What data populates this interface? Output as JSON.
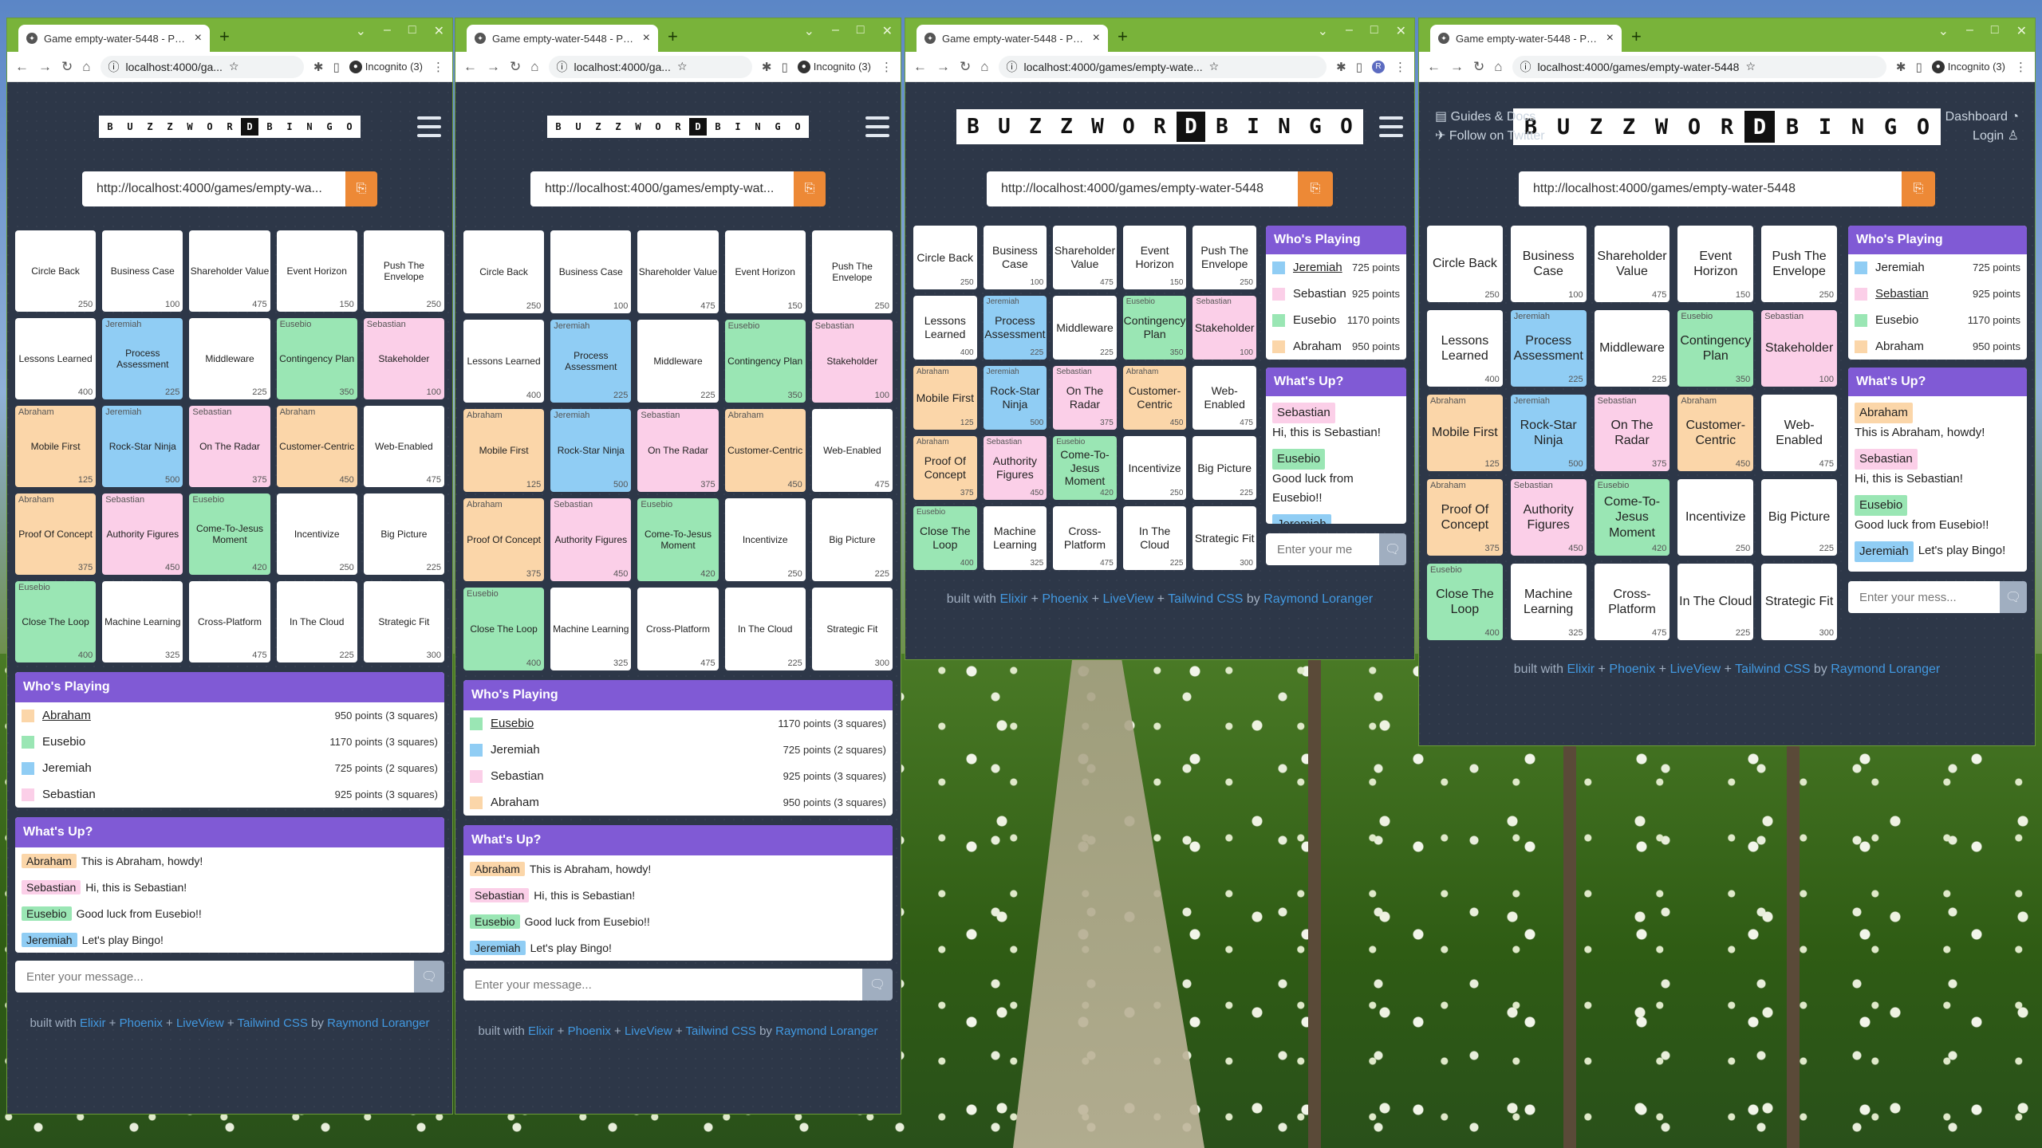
{
  "browser": {
    "tab_title": "Game empty-water-5448 - Phoenix",
    "new_tab": "+",
    "url_short": "localhost:4000/ga...",
    "url_long": "localhost:4000/games/empty-wate...",
    "url_full": "localhost:4000/games/empty-water-5448",
    "incognito": "Incognito (3)",
    "profile_initial": "R"
  },
  "logo": [
    "B",
    "U",
    "Z",
    "Z",
    "W",
    "O",
    "R",
    "D",
    "B",
    "I",
    "N",
    "G",
    "O"
  ],
  "header_links": {
    "guides": "Guides & Docs",
    "twitter": "Follow on Twitter",
    "dashboard": "Dashboard",
    "login": "Login"
  },
  "game_url": "http://localhost:4000/games/empty-water-5448",
  "game_url_short": "http://localhost:4000/games/empty-wa...",
  "game_url_short2": "http://localhost:4000/games/empty-wat...",
  "board": [
    {
      "label": "Circle Back",
      "points": "250",
      "by": "",
      "color": ""
    },
    {
      "label": "Business Case",
      "points": "100",
      "by": "",
      "color": ""
    },
    {
      "label": "Shareholder Value",
      "points": "475",
      "by": "",
      "color": ""
    },
    {
      "label": "Event Horizon",
      "points": "150",
      "by": "",
      "color": ""
    },
    {
      "label": "Push The Envelope",
      "points": "250",
      "by": "",
      "color": ""
    },
    {
      "label": "Lessons Learned",
      "points": "400",
      "by": "",
      "color": ""
    },
    {
      "label": "Process Assessment",
      "points": "225",
      "by": "Jeremiah",
      "color": "jeremiah"
    },
    {
      "label": "Middleware",
      "points": "225",
      "by": "",
      "color": ""
    },
    {
      "label": "Contingency Plan",
      "points": "350",
      "by": "Eusebio",
      "color": "eusebio"
    },
    {
      "label": "Stakeholder",
      "points": "100",
      "by": "Sebastian",
      "color": "sebastian"
    },
    {
      "label": "Mobile First",
      "points": "125",
      "by": "Abraham",
      "color": "abraham"
    },
    {
      "label": "Rock-Star Ninja",
      "points": "500",
      "by": "Jeremiah",
      "color": "jeremiah"
    },
    {
      "label": "On The Radar",
      "points": "375",
      "by": "Sebastian",
      "color": "sebastian"
    },
    {
      "label": "Customer-Centric",
      "points": "450",
      "by": "Abraham",
      "color": "abraham"
    },
    {
      "label": "Web-Enabled",
      "points": "475",
      "by": "",
      "color": ""
    },
    {
      "label": "Proof Of Concept",
      "points": "375",
      "by": "Abraham",
      "color": "abraham"
    },
    {
      "label": "Authority Figures",
      "points": "450",
      "by": "Sebastian",
      "color": "sebastian"
    },
    {
      "label": "Come-To-Jesus Moment",
      "points": "420",
      "by": "Eusebio",
      "color": "eusebio"
    },
    {
      "label": "Incentivize",
      "points": "250",
      "by": "",
      "color": ""
    },
    {
      "label": "Big Picture",
      "points": "225",
      "by": "",
      "color": ""
    },
    {
      "label": "Close The Loop",
      "points": "400",
      "by": "Eusebio",
      "color": "eusebio"
    },
    {
      "label": "Machine Learning",
      "points": "325",
      "by": "",
      "color": ""
    },
    {
      "label": "Cross-Platform",
      "points": "475",
      "by": "",
      "color": ""
    },
    {
      "label": "In The Cloud",
      "points": "225",
      "by": "",
      "color": ""
    },
    {
      "label": "Strategic Fit",
      "points": "300",
      "by": "",
      "color": ""
    }
  ],
  "whos_playing_title": "Who's Playing",
  "whats_up_title": "What's Up?",
  "players_w1": [
    {
      "name": "Abraham",
      "points": "950 points (3 squares)",
      "color": "abraham",
      "underline": true
    },
    {
      "name": "Eusebio",
      "points": "1170 points (3 squares)",
      "color": "eusebio",
      "underline": false
    },
    {
      "name": "Jeremiah",
      "points": "725 points (2 squares)",
      "color": "jeremiah",
      "underline": false
    },
    {
      "name": "Sebastian",
      "points": "925 points (3 squares)",
      "color": "sebastian",
      "underline": false
    }
  ],
  "players_w2": [
    {
      "name": "Eusebio",
      "points": "1170 points (3 squares)",
      "color": "eusebio",
      "underline": true
    },
    {
      "name": "Jeremiah",
      "points": "725 points (2 squares)",
      "color": "jeremiah",
      "underline": false
    },
    {
      "name": "Sebastian",
      "points": "925 points (3 squares)",
      "color": "sebastian",
      "underline": false
    },
    {
      "name": "Abraham",
      "points": "950 points (3 squares)",
      "color": "abraham",
      "underline": false
    }
  ],
  "players_w3": [
    {
      "name": "Jeremiah",
      "points": "725 points",
      "color": "jeremiah",
      "underline": true
    },
    {
      "name": "Sebastian",
      "points": "925 points",
      "color": "sebastian",
      "underline": false
    },
    {
      "name": "Eusebio",
      "points": "1170 points",
      "color": "eusebio",
      "underline": false
    },
    {
      "name": "Abraham",
      "points": "950 points",
      "color": "abraham",
      "underline": false
    }
  ],
  "players_w4": [
    {
      "name": "Jeremiah",
      "points": "725 points",
      "color": "jeremiah",
      "underline": false
    },
    {
      "name": "Sebastian",
      "points": "925 points",
      "color": "sebastian",
      "underline": true
    },
    {
      "name": "Eusebio",
      "points": "1170 points",
      "color": "eusebio",
      "underline": false
    },
    {
      "name": "Abraham",
      "points": "950 points",
      "color": "abraham",
      "underline": false
    }
  ],
  "messages": [
    {
      "from": "Abraham",
      "color": "abraham",
      "text": "This is Abraham, howdy!"
    },
    {
      "from": "Sebastian",
      "color": "sebastian",
      "text": "Hi, this is Sebastian!"
    },
    {
      "from": "Eusebio",
      "color": "eusebio",
      "text": "Good luck from Eusebio!!"
    },
    {
      "from": "Jeremiah",
      "color": "jeremiah",
      "text": "Let's play Bingo!"
    }
  ],
  "message_placeholder": "Enter your message...",
  "message_placeholder_short1": "Enter your me",
  "message_placeholder_short2": "Enter your mess...",
  "footer": {
    "prefix": "built with",
    "links": [
      "Elixir",
      "Phoenix",
      "LiveView",
      "Tailwind CSS"
    ],
    "plus": "+",
    "by": "by",
    "author": "Raymond Loranger"
  },
  "colors": {
    "abraham": "#fbd6a9",
    "eusebio": "#9ae6b4",
    "jeremiah": "#90cdf4",
    "sebastian": "#fbcfe8",
    "header_purple": "#805ad5",
    "copy_orange": "#ed8936",
    "page_bg": "#2d3748"
  }
}
